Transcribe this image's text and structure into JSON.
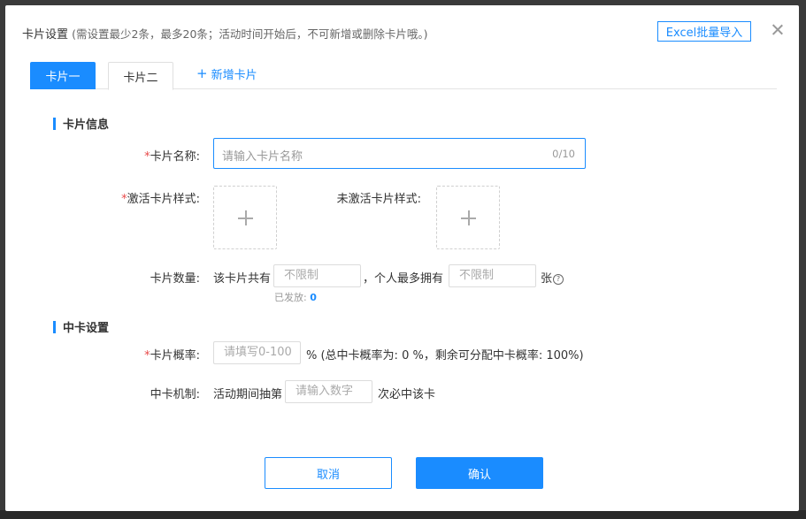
{
  "dialog": {
    "title": "卡片设置",
    "subtitle": "(需设置最少2条，最多20条；活动时间开始后，不可新增或删除卡片哦。)",
    "excel_button": "Excel批量导入"
  },
  "tabs": [
    {
      "label": "卡片一",
      "active": true
    },
    {
      "label": "卡片二",
      "active": false
    }
  ],
  "add_tab_label": "新增卡片",
  "card_info": {
    "section_title": "卡片信息",
    "name_label": "卡片名称:",
    "name_placeholder": "请输入卡片名称",
    "name_count": "0/10",
    "active_style_label": "激活卡片样式:",
    "inactive_style_label": "未激活卡片样式:",
    "quantity_label": "卡片数量:",
    "quantity_prefix": "该卡片共有",
    "quantity_placeholder": "不限制",
    "per_person_prefix": "，个人最多拥有",
    "per_person_placeholder": "不限制",
    "per_person_suffix": "张",
    "issued_label": "已发放:",
    "issued_value": "0"
  },
  "winning": {
    "section_title": "中卡设置",
    "probability_label": "卡片概率:",
    "probability_placeholder": "请填写0-100",
    "probability_suffix": "% (总中卡概率为: 0 %，剩余可分配中卡概率: 100%)",
    "mechanism_label": "中卡机制:",
    "mechanism_prefix": "活动期间抽第",
    "mechanism_placeholder": "请输入数字",
    "mechanism_suffix": "次必中该卡"
  },
  "footer": {
    "cancel": "取消",
    "confirm": "确认"
  },
  "colors": {
    "accent": "#1a8cff",
    "required": "#e84a4a"
  },
  "icons": [
    "close-icon",
    "plus-icon",
    "question-circle-icon"
  ]
}
